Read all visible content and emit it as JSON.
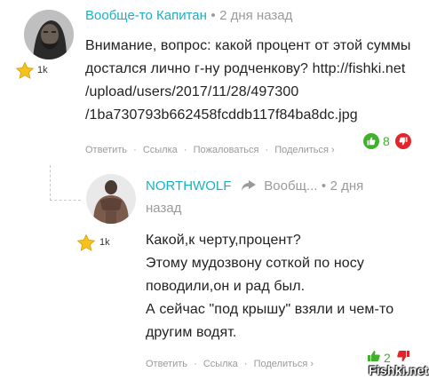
{
  "comment1": {
    "author": "Вообще-то Капитан",
    "separator": "•",
    "time": "2 дня назад",
    "karma": "1k",
    "text_lines": [
      "Внимание, вопрос: какой процент от этой суммы",
      "достался лично г-ну родченкову? http://fishki.net",
      "/upload/users/2017/11/28/497300",
      "/1ba730793b662458fcddb117f84ba8dc.jpg"
    ],
    "actions": {
      "reply": "Ответить",
      "link": "Ссылка",
      "report": "Пожаловаться",
      "share": "Поделиться ›"
    },
    "votes": "8"
  },
  "comment2": {
    "author": "NORTHWOLF",
    "reply_to": "Вообщ...",
    "separator": "•",
    "time_line1": "2 дня",
    "time_line2": "назад",
    "karma": "1k",
    "text_lines": [
      "Какой,к черту,процент?",
      "Этому мудозвону соткой по носу",
      "поводили,он и рад был.",
      "А сейчас \"под крышу\" взяли и чем-то",
      "другим водят."
    ],
    "actions": {
      "reply": "Ответить",
      "link": "Ссылка",
      "share": "Поделиться ›"
    },
    "votes": "2"
  },
  "watermark": "Fishki.net",
  "colors": {
    "username": "#1ab0c5",
    "upvote": "#3fb12b",
    "downvote": "#e0262b",
    "star": "#f4c21b",
    "muted": "#9a9a9a"
  },
  "icons": {
    "karma": "star-icon",
    "thumbs_up": "thumbs-up-icon",
    "thumbs_down": "thumbs-down-icon",
    "reply_arrow": "reply-arrow-icon"
  }
}
